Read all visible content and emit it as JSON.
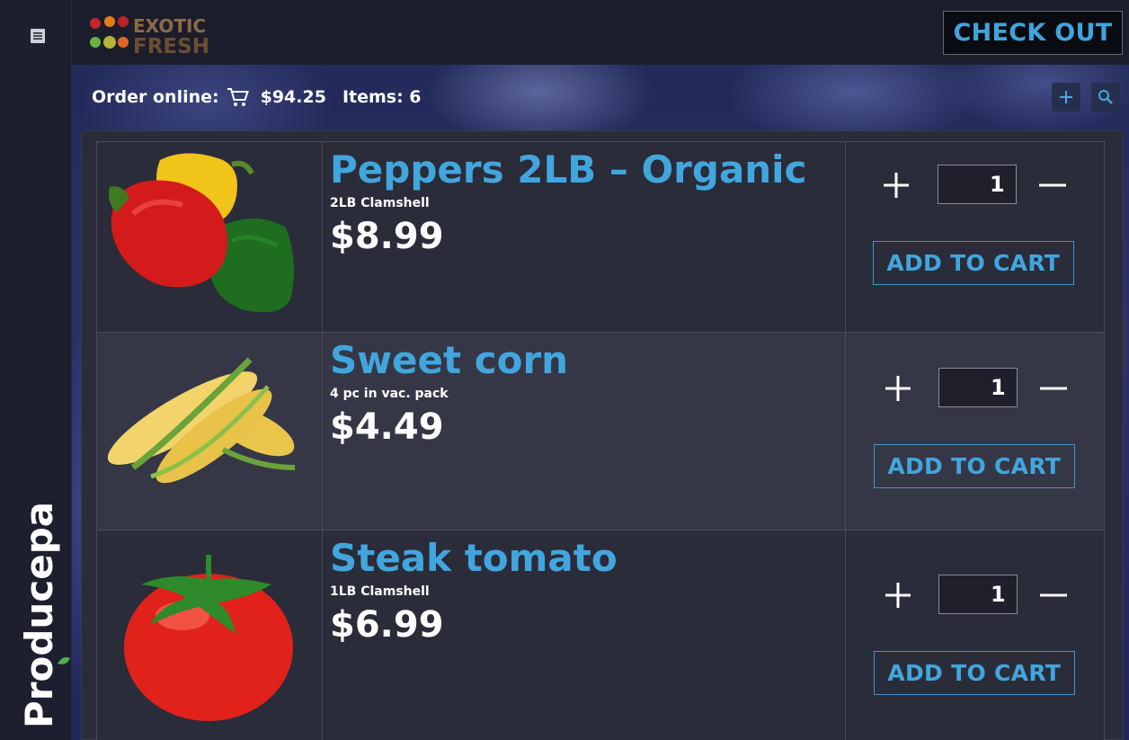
{
  "brand": {
    "logo_line1": "EXOTIC",
    "logo_line2": "FRESH",
    "vertical_brand": "Producepak"
  },
  "header": {
    "checkout_label": "CHECK OUT"
  },
  "order": {
    "label": "Order online:",
    "total": "$94.25",
    "items_label": "Items: 6"
  },
  "icons": {
    "menu": "menu-icon",
    "cart": "cart-icon",
    "add": "plus-icon",
    "search": "search-icon"
  },
  "products": [
    {
      "name": "Peppers 2LB – Organic",
      "subtitle": "2LB Clamshell",
      "price": "$8.99",
      "qty": "1",
      "add_label": "ADD TO CART",
      "image": "bell-peppers"
    },
    {
      "name": "Sweet corn",
      "subtitle": "4 pc in vac. pack",
      "price": "$4.49",
      "qty": "1",
      "add_label": "ADD TO CART",
      "image": "corn"
    },
    {
      "name": "Steak tomato",
      "subtitle": "1LB Clamshell",
      "price": "$6.99",
      "qty": "1",
      "add_label": "ADD TO CART",
      "image": "tomato"
    }
  ],
  "colors": {
    "accent": "#41a6dd",
    "background": "#1c1d2b",
    "panel": "#2b2c3a"
  }
}
